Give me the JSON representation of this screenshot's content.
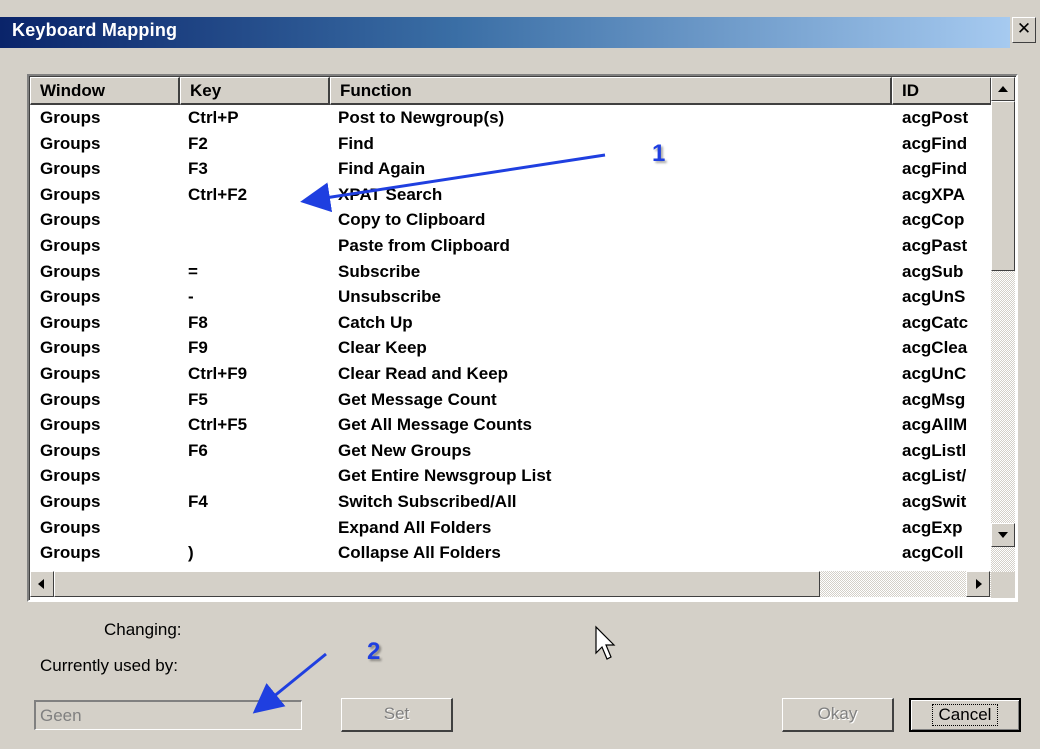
{
  "window": {
    "title": "Keyboard Mapping",
    "close_glyph": "✕"
  },
  "table": {
    "columns": [
      "Window",
      "Key",
      "Function",
      "ID"
    ],
    "rows": [
      {
        "window": "Groups",
        "key": "Ctrl+P",
        "function": "Post to Newgroup(s)",
        "id": "acgPost"
      },
      {
        "window": "Groups",
        "key": "F2",
        "function": "Find",
        "id": "acgFind"
      },
      {
        "window": "Groups",
        "key": "F3",
        "function": "Find Again",
        "id": "acgFind"
      },
      {
        "window": "Groups",
        "key": "Ctrl+F2",
        "function": "XPAT Search",
        "id": "acgXPA"
      },
      {
        "window": "Groups",
        "key": "",
        "function": "Copy to Clipboard",
        "id": "acgCop"
      },
      {
        "window": "Groups",
        "key": "",
        "function": "Paste from Clipboard",
        "id": "acgPast"
      },
      {
        "window": "Groups",
        "key": "=",
        "function": "Subscribe",
        "id": "acgSub"
      },
      {
        "window": "Groups",
        "key": "-",
        "function": "Unsubscribe",
        "id": "acgUnS"
      },
      {
        "window": "Groups",
        "key": "F8",
        "function": "Catch Up",
        "id": "acgCatc"
      },
      {
        "window": "Groups",
        "key": "F9",
        "function": "Clear Keep",
        "id": "acgClea"
      },
      {
        "window": "Groups",
        "key": "Ctrl+F9",
        "function": "Clear Read and Keep",
        "id": "acgUnC"
      },
      {
        "window": "Groups",
        "key": "F5",
        "function": "Get Message Count",
        "id": "acgMsg"
      },
      {
        "window": "Groups",
        "key": "Ctrl+F5",
        "function": "Get All Message Counts",
        "id": "acgAllM"
      },
      {
        "window": "Groups",
        "key": "F6",
        "function": "Get New Groups",
        "id": "acgListl"
      },
      {
        "window": "Groups",
        "key": "",
        "function": "Get Entire Newsgroup List",
        "id": "acgList/"
      },
      {
        "window": "Groups",
        "key": "F4",
        "function": "Switch Subscribed/All",
        "id": "acgSwit"
      },
      {
        "window": "Groups",
        "key": "",
        "function": "Expand All Folders",
        "id": "acgExp"
      },
      {
        "window": "Groups",
        "key": ")",
        "function": "Collapse All Folders",
        "id": "acgColl"
      }
    ]
  },
  "form": {
    "changing_label": "Changing:",
    "used_by_label": "Currently used by:",
    "key_input_value": "Geen",
    "set_button": "Set",
    "okay_button": "Okay",
    "cancel_button": "Cancel"
  },
  "annotations": {
    "one": "1",
    "two": "2",
    "arrow_color": "#1f3fe0"
  },
  "icons": [
    "close-icon",
    "scroll-up-arrow-icon",
    "scroll-down-arrow-icon",
    "scroll-left-arrow-icon",
    "scroll-right-arrow-icon",
    "mouse-cursor-icon"
  ]
}
